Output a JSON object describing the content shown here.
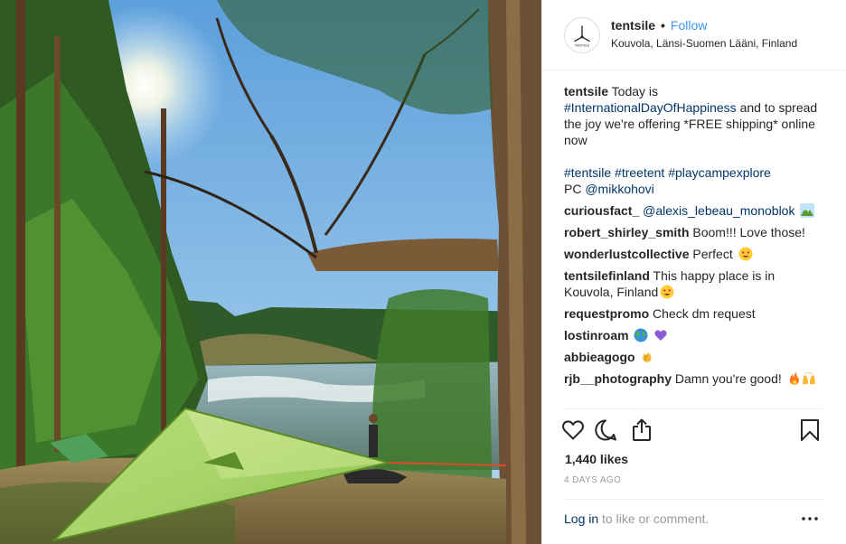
{
  "header": {
    "username": "tentsile",
    "dot": "•",
    "follow": "Follow",
    "location": "Kouvola, Länsi-Suomen Lääni, Finland",
    "avatar_icon": "tentsile-logo-icon",
    "avatar_text": "TENTSILE"
  },
  "caption": {
    "user": "tentsile",
    "text1": "Today is",
    "hashtag_day": "#InternationalDayOfHappiness",
    "text2": "and to spread the joy we're offering *FREE shipping* online now",
    "hashtags": [
      "#tentsile",
      "#treetent",
      "#playcampexplore"
    ],
    "pc_label": "PC",
    "pc_user": "@mikkohovi"
  },
  "comments": [
    {
      "user": "curiousfact_",
      "text": "",
      "mention": "@alexis_lebeau_monoblok",
      "emoji": "mountain-emoji"
    },
    {
      "user": "robert_shirley_smith",
      "text": "Boom!!! Love those!",
      "mention": "",
      "emoji": ""
    },
    {
      "user": "wonderlustcollective",
      "text": "Perfect",
      "mention": "",
      "emoji": "heart-eyes-emoji"
    },
    {
      "user": "tentsilefinland",
      "text": "This happy place is in Kouvola, Finland",
      "mention": "",
      "emoji": "heart-eyes-emoji"
    },
    {
      "user": "requestpromo",
      "text": "Check dm request",
      "mention": "",
      "emoji": ""
    },
    {
      "user": "lostinroam",
      "text": "",
      "mention": "",
      "emoji": "globe-emoji purple-heart-emoji"
    },
    {
      "user": "abbieagogo",
      "text": "",
      "mention": "",
      "emoji": "clapping-hands-emoji"
    },
    {
      "user": "rjb__photography",
      "text": "Damn you're good!",
      "mention": "",
      "emoji": "fire-emoji raised-hands-emoji"
    }
  ],
  "actions": {
    "like_icon": "heart-icon",
    "comment_icon": "comment-icon",
    "share_icon": "share-icon",
    "save_icon": "bookmark-icon"
  },
  "likes": "1,440 likes",
  "date": "4 DAYS AGO",
  "login": {
    "link": "Log in",
    "text": "to like or comment.",
    "more": "•••"
  },
  "colors": {
    "link": "#003569",
    "follow": "#3897f0",
    "muted": "#999999",
    "border": "#efefef"
  }
}
